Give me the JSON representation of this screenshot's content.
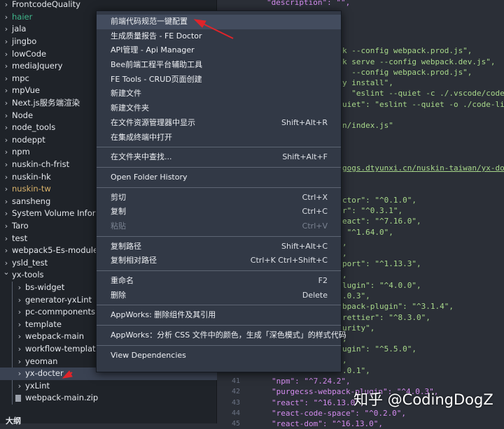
{
  "explorer": {
    "items": [
      {
        "label": "FrontcodeQuality",
        "indent": 0,
        "type": "folder"
      },
      {
        "label": "haier",
        "indent": 0,
        "type": "folder",
        "color": "#3fb68b"
      },
      {
        "label": "jala",
        "indent": 0,
        "type": "folder"
      },
      {
        "label": "jingbo",
        "indent": 0,
        "type": "folder"
      },
      {
        "label": "lowCode",
        "indent": 0,
        "type": "folder"
      },
      {
        "label": "mediaJquery",
        "indent": 0,
        "type": "folder"
      },
      {
        "label": "mpc",
        "indent": 0,
        "type": "folder"
      },
      {
        "label": "mpVue",
        "indent": 0,
        "type": "folder"
      },
      {
        "label": "Next.js服务端渲染",
        "indent": 0,
        "type": "folder"
      },
      {
        "label": "Node",
        "indent": 0,
        "type": "folder"
      },
      {
        "label": "node_tools",
        "indent": 0,
        "type": "folder"
      },
      {
        "label": "nodeppt",
        "indent": 0,
        "type": "folder"
      },
      {
        "label": "npm",
        "indent": 0,
        "type": "folder"
      },
      {
        "label": "nuskin-ch-frist",
        "indent": 0,
        "type": "folder"
      },
      {
        "label": "nuskin-hk",
        "indent": 0,
        "type": "folder"
      },
      {
        "label": "nuskin-tw",
        "indent": 0,
        "type": "folder",
        "color": "#d9b26a"
      },
      {
        "label": "sansheng",
        "indent": 0,
        "type": "folder"
      },
      {
        "label": "System Volume Informa",
        "indent": 0,
        "type": "folder"
      },
      {
        "label": "Taro",
        "indent": 0,
        "type": "folder"
      },
      {
        "label": "test",
        "indent": 0,
        "type": "folder"
      },
      {
        "label": "webpack5-Es-module",
        "indent": 0,
        "type": "folder"
      },
      {
        "label": "ysld_test",
        "indent": 0,
        "type": "folder"
      },
      {
        "label": "yx-tools",
        "indent": 0,
        "type": "open"
      },
      {
        "label": "bs-widget",
        "indent": 1,
        "type": "folder"
      },
      {
        "label": "generator-yxLint",
        "indent": 1,
        "type": "folder"
      },
      {
        "label": "pc-commponents",
        "indent": 1,
        "type": "folder"
      },
      {
        "label": "template",
        "indent": 1,
        "type": "folder"
      },
      {
        "label": "webpack-main",
        "indent": 1,
        "type": "folder"
      },
      {
        "label": "workflow-template-ma",
        "indent": 1,
        "type": "folder"
      },
      {
        "label": "yeoman",
        "indent": 1,
        "type": "folder"
      },
      {
        "label": "yx-docter",
        "indent": 1,
        "type": "folder",
        "selected": true
      },
      {
        "label": "yxLint",
        "indent": 1,
        "type": "folder"
      },
      {
        "label": "webpack-main.zip",
        "indent": 1,
        "type": "file"
      }
    ],
    "outline_label": "大纲"
  },
  "editor": {
    "top_line": "\"description\": \"\",",
    "fragments": [
      {
        "t": "k --config webpack.prod.js\","
      },
      {
        "t": "k serve --config webpack.dev.js\","
      },
      {
        "t": "  --config webpack.prod.js\","
      },
      {
        "t": "y install\","
      },
      {
        "t": "  \"eslint --quiet -c ./.vscode/code-lin"
      },
      {
        "t": "uiet\": \"eslint --quiet -o ./code-lint-"
      },
      {
        "t": ""
      },
      {
        "t": "n/index.js\""
      },
      {
        "t": ""
      },
      {
        "t": ""
      },
      {
        "t": ""
      },
      {
        "t": "gogs.dtyunxi.cn/nuskin-taiwan/yx-docter",
        "link": true
      },
      {
        "t": ""
      },
      {
        "t": ""
      },
      {
        "t": "ctor\": \"^0.1.0\","
      },
      {
        "t": "r\": \"^0.3.1\","
      },
      {
        "t": "eact\": \"^7.16.0\","
      },
      {
        "t": " \"^1.64.0\","
      },
      {
        "t": ","
      },
      {
        "t": ","
      },
      {
        "t": "port\": \"^1.13.3\","
      },
      {
        "t": ","
      },
      {
        "t": "lugin\": \"^4.0.0\","
      },
      {
        "t": ".0.3\","
      },
      {
        "t": "bpack-plugin\": \"^3.1.4\","
      },
      {
        "t": "rettier\": \"^8.3.0\","
      },
      {
        "t": "urity\","
      },
      {
        "t": ","
      },
      {
        "t": "ugin\": \"^5.5.0\","
      },
      {
        "t": ","
      },
      {
        "t": ".0.1\","
      }
    ],
    "lines": [
      {
        "n": "41",
        "t": "\"npm\": \"^7.24.2\","
      },
      {
        "n": "42",
        "t": "\"purgecss-webpack-plugin\": \"^4.0.3\","
      },
      {
        "n": "43",
        "t": "\"react\": \"^16.13.0\","
      },
      {
        "n": "44",
        "t": "\"react-code-space\": \"^0.2.0\","
      },
      {
        "n": "45",
        "t": "\"react-dom\": \"^16.13.0\","
      }
    ]
  },
  "menu": {
    "groups": [
      [
        {
          "label": "前端代码规范一键配置",
          "hl": true
        },
        {
          "label": "生成质量报告 - FE Doctor"
        },
        {
          "label": "API管理 - Api Manager"
        },
        {
          "label": "Bee前端工程平台辅助工具"
        },
        {
          "label": "FE Tools - CRUD页面创建"
        },
        {
          "label": "新建文件"
        },
        {
          "label": "新建文件夹"
        },
        {
          "label": "在文件资源管理器中显示",
          "shortcut": "Shift+Alt+R"
        },
        {
          "label": "在集成终端中打开"
        }
      ],
      [
        {
          "label": "在文件夹中查找...",
          "shortcut": "Shift+Alt+F"
        }
      ],
      [
        {
          "label": "Open Folder History"
        }
      ],
      [
        {
          "label": "剪切",
          "shortcut": "Ctrl+X"
        },
        {
          "label": "复制",
          "shortcut": "Ctrl+C"
        },
        {
          "label": "粘贴",
          "shortcut": "Ctrl+V",
          "disabled": true
        }
      ],
      [
        {
          "label": "复制路径",
          "shortcut": "Shift+Alt+C"
        },
        {
          "label": "复制相对路径",
          "shortcut": "Ctrl+K Ctrl+Shift+C"
        }
      ],
      [
        {
          "label": "重命名",
          "shortcut": "F2"
        },
        {
          "label": "删除",
          "shortcut": "Delete"
        }
      ],
      [
        {
          "label": "AppWorks: 删除组件及其引用"
        }
      ],
      [
        {
          "label": "AppWorks：分析 CSS 文件中的颜色，生成「深色模式」的样式代码"
        }
      ],
      [
        {
          "label": "View Dependencies"
        }
      ]
    ]
  },
  "watermark": "知乎 @CodingDogZ",
  "colors": {
    "arrow": "#e0242a",
    "accent_string": "#98c379",
    "key": "#c678dd"
  }
}
